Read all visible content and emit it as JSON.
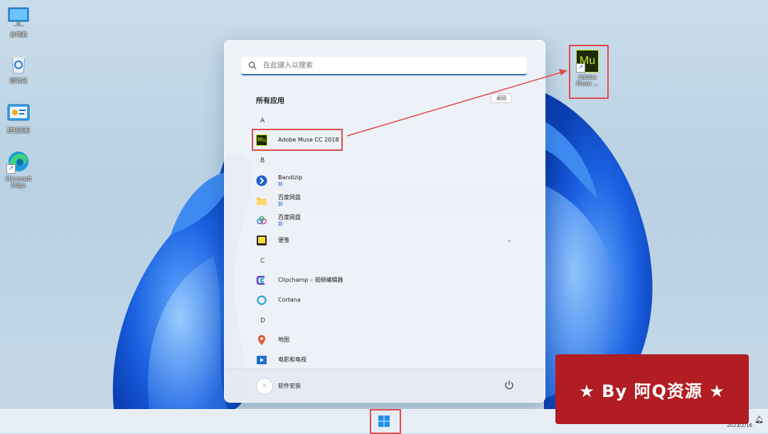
{
  "desktop": {
    "icons": [
      {
        "label": "此电脑",
        "icon": "monitor-icon"
      },
      {
        "label": "回收站",
        "icon": "recycle-bin-icon"
      },
      {
        "label": "控制面板",
        "icon": "control-panel-icon"
      },
      {
        "label": "Microsoft Edge",
        "icon": "edge-icon"
      }
    ],
    "muse_shortcut": {
      "label": "Adobe Muse ...",
      "icon": "adobe-muse-icon",
      "glyph": "Mu"
    }
  },
  "start_menu": {
    "search_placeholder": "在此键入以搜索",
    "all_apps_title": "所有应用",
    "back_label": "返回",
    "groups": [
      {
        "letter": "A",
        "apps": [
          {
            "name": "Adobe Muse CC 2018",
            "new": "",
            "icon": "adobe-muse-icon"
          }
        ]
      },
      {
        "letter": "B",
        "apps": [
          {
            "name": "Bandizip",
            "new": "新",
            "icon": "bandizip-icon"
          },
          {
            "name": "百度网盘",
            "new": "新",
            "icon": "folder-icon"
          },
          {
            "name": "百度网盘",
            "new": "新",
            "icon": "baidu-netdisk-icon"
          },
          {
            "name": "便笺",
            "new": "",
            "icon": "sticky-notes-icon"
          }
        ]
      },
      {
        "letter": "C",
        "apps": [
          {
            "name": "Clipchamp – 视频编辑器",
            "new": "",
            "icon": "clipchamp-icon"
          },
          {
            "name": "Cortana",
            "new": "",
            "icon": "cortana-icon"
          }
        ]
      },
      {
        "letter": "D",
        "apps": [
          {
            "name": "地图",
            "new": "",
            "icon": "maps-icon"
          },
          {
            "name": "电影和电视",
            "new": "",
            "icon": "movies-tv-icon"
          }
        ]
      }
    ],
    "footer": {
      "user_name": "软件安装",
      "power_icon": "power-icon"
    }
  },
  "taskbar": {
    "start_icon": "windows-start-icon",
    "date": "2023/2/16"
  },
  "watermark": {
    "text": "★ By 阿Q资源 ★"
  },
  "colors": {
    "accent": "#2f6fbd",
    "highlight": "#e24a4a",
    "banner": "#b11d23",
    "muse_bg": "#1b2a0a",
    "muse_fg": "#c9e81f"
  }
}
